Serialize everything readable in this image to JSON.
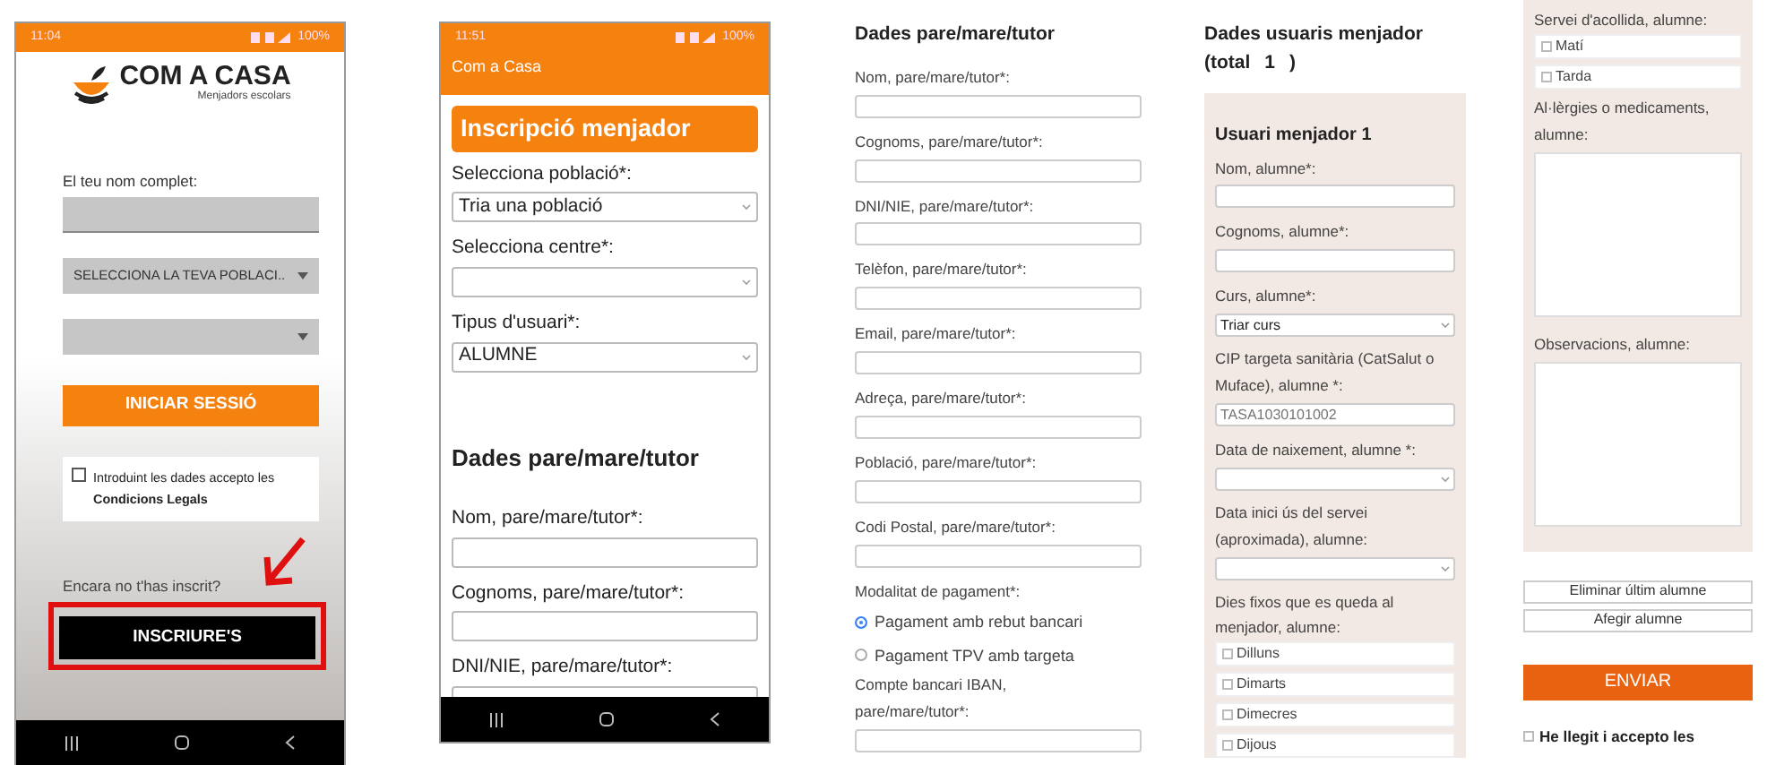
{
  "login_screen": {
    "status_time": "11:04",
    "status_battery": "100%",
    "logo_title": "COM A CASA",
    "logo_subtitle": "Menjadors escolars",
    "name_label": "El teu nom complet:",
    "town_select": "SELECCIONA LA TEVA POBLACI..",
    "login_button": "INICIAR SESSIÓ",
    "terms": {
      "checked": false,
      "text": "Introduint les dades accepto les",
      "link": "Condicions Legals"
    },
    "register_prompt": "Encara no t'has inscrit?",
    "register_button": "INSCRIURE'S",
    "register_highlighted": true
  },
  "registration_screen": {
    "status_time": "11:51",
    "status_battery": "100%",
    "app_title": "Com a Casa",
    "heading": "Inscripció menjador",
    "fields": [
      {
        "kind": "select",
        "label": "Selecciona població*:",
        "value": "Tria una població"
      },
      {
        "kind": "select",
        "label": "Selecciona centre*:"
      },
      {
        "kind": "select",
        "label": "Tipus d'usuari*:",
        "value": "ALUMNE"
      }
    ],
    "section_title": "Dades pare/mare/tutor",
    "section_fields": [
      {
        "kind": "text",
        "label": "Nom, pare/mare/tutor*:"
      },
      {
        "kind": "text",
        "label": "Cognoms, pare/mare/tutor*:"
      },
      {
        "kind": "text",
        "label": "DNI/NIE, pare/mare/tutor*:"
      }
    ]
  },
  "parent_form": {
    "heading": "Dades pare/mare/tutor",
    "fields": [
      {
        "kind": "text",
        "label": "Nom, pare/mare/tutor*:"
      },
      {
        "kind": "text",
        "label": "Cognoms, pare/mare/tutor*:"
      },
      {
        "kind": "text",
        "label": "DNI/NIE, pare/mare/tutor*:"
      },
      {
        "kind": "text",
        "label": "Telèfon, pare/mare/tutor*:"
      },
      {
        "kind": "text",
        "label": "Email, pare/mare/tutor*:"
      },
      {
        "kind": "text",
        "label": "Adreça, pare/mare/tutor*:"
      },
      {
        "kind": "text",
        "label": "Població, pare/mare/tutor*:"
      },
      {
        "kind": "text",
        "label": "Codi Postal, pare/mare/tutor*:"
      },
      {
        "kind": "radio",
        "label": "Modalitat de pagament*:",
        "options": [
          {
            "label": "Pagament amb rebut bancari",
            "selected": true
          },
          {
            "label": "Pagament TPV amb targeta",
            "selected": false
          }
        ]
      },
      {
        "kind": "text",
        "label": "Compte bancari IBAN, pare/mare/tutor*:"
      }
    ]
  },
  "users_form": {
    "heading": "Dades usuaris menjador",
    "total_prefix": "(total",
    "total": "1",
    "total_suffix": ")",
    "card_title": "Usuari menjador 1",
    "fields": [
      {
        "kind": "text",
        "label": "Nom, alumne*:"
      },
      {
        "kind": "text",
        "label": "Cognoms, alumne*:"
      },
      {
        "kind": "select",
        "label": "Curs, alumne*:",
        "value": "Triar curs"
      },
      {
        "kind": "text",
        "label": "CIP targeta sanitària (CatSalut o Muface), alumne *:",
        "placeholder": "TASA1030101002"
      },
      {
        "kind": "select",
        "label": "Data de naixement, alumne *:"
      },
      {
        "kind": "select",
        "label": "Data inici ús del servei (aproximada), alumne:"
      },
      {
        "kind": "checks",
        "label": "Dies fixos que es queda al menjador, alumne:",
        "options": [
          {
            "label": "Dilluns",
            "checked": false
          },
          {
            "label": "Dimarts",
            "checked": false
          },
          {
            "label": "Dimecres",
            "checked": false
          },
          {
            "label": "Dijous",
            "checked": false
          }
        ]
      }
    ]
  },
  "users_form_continued": {
    "fields": [
      {
        "kind": "checks",
        "label": "Servei d'acollida, alumne:",
        "options": [
          {
            "label": "Matí",
            "checked": false
          },
          {
            "label": "Tarda",
            "checked": false
          }
        ]
      },
      {
        "kind": "textarea",
        "label": "Al·lèrgies o medicaments, alumne:"
      },
      {
        "kind": "textarea",
        "label": "Observacions, alumne:"
      }
    ],
    "buttons": [
      "Eliminar últim alumne",
      "Afegir alumne"
    ],
    "submit": "ENVIAR",
    "terms": {
      "checked": false,
      "text": "He llegit i accepto les"
    }
  }
}
